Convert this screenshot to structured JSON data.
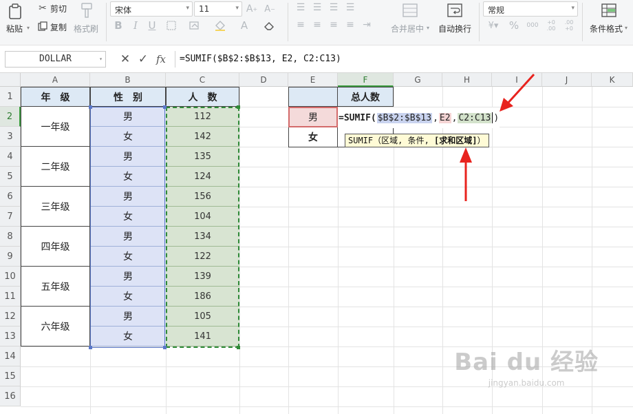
{
  "ribbon": {
    "paste": "粘贴",
    "cut": "剪切",
    "copy": "复制",
    "format_painter": "格式刷",
    "font_name": "宋体",
    "font_size": "11",
    "merge_center": "合并居中",
    "wrap_text": "自动换行",
    "number_format": "常规",
    "conditional_format": "条件格式",
    "bold": "B",
    "italic": "I",
    "underline": "U",
    "increase_font": "A⁺",
    "decrease_font": "A⁻",
    "percent": "%",
    "thousands": "000",
    "inc_decimal": "+0 .00",
    "dec_decimal": ".00 +0"
  },
  "formula_bar": {
    "name_box": "DOLLAR",
    "cancel": "✕",
    "confirm": "✓",
    "fx": "fx",
    "formula": "=SUMIF($B$2:$B$13, E2, C2:C13)"
  },
  "columns": [
    "A",
    "B",
    "C",
    "D",
    "E",
    "F",
    "G",
    "H",
    "I",
    "J",
    "K"
  ],
  "rows": [
    "1",
    "2",
    "3",
    "4",
    "5",
    "6",
    "7",
    "8",
    "9",
    "10",
    "11",
    "12",
    "13",
    "14",
    "15",
    "16"
  ],
  "table": {
    "headers": [
      "年　级",
      "性　别",
      "人　数"
    ],
    "grades": [
      "一年级",
      "二年级",
      "三年级",
      "四年级",
      "五年级",
      "六年级"
    ],
    "genders": [
      "男",
      "女",
      "男",
      "女",
      "男",
      "女",
      "男",
      "女",
      "男",
      "女",
      "男",
      "女"
    ],
    "counts": [
      "112",
      "142",
      "135",
      "124",
      "156",
      "104",
      "134",
      "122",
      "139",
      "186",
      "105",
      "141"
    ]
  },
  "summary": {
    "header": "总人数",
    "male": "男",
    "female": "女"
  },
  "editing": {
    "prefix": "=SUMIF(",
    "arg1": "$B$2:$B$13",
    "sep1": ", ",
    "arg2": "E2",
    "sep2": ", ",
    "arg3": "C2:C13",
    "suffix": ")"
  },
  "tooltip": {
    "func": "SUMIF（区域, 条件, ",
    "optional": "[求和区域]",
    "end": "）"
  },
  "watermark": {
    "main": "Bai du 经验",
    "sub": "jingyan.baidu.com"
  },
  "colors": {
    "header_fill": "#dde9f5",
    "gender_fill": "#dde3f6",
    "count_fill": "#d8e4d2",
    "active_green": "#3a9a3e",
    "arrow_red": "#e8231e"
  }
}
